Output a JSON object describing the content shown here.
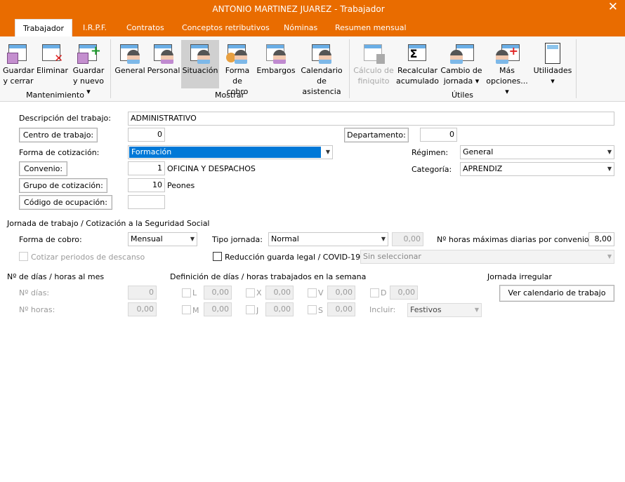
{
  "window": {
    "title": "ANTONIO MARTINEZ JUAREZ - Trabajador",
    "close_icon": "close-icon"
  },
  "tabs": [
    "Trabajador",
    "I.R.P.F.",
    "Contratos",
    "Conceptos retributivos",
    "Nóminas",
    "Resumen mensual"
  ],
  "ribbon": {
    "groups": [
      "Mantenimiento",
      "Mostrar",
      "Útiles"
    ],
    "buttons": [
      {
        "l1": "Guardar",
        "l2": "y cerrar"
      },
      {
        "l1": "Eliminar",
        "l2": ""
      },
      {
        "l1": "Guardar",
        "l2": "y nuevo ▾"
      },
      {
        "l1": "General",
        "l2": ""
      },
      {
        "l1": "Personal",
        "l2": ""
      },
      {
        "l1": "Situación",
        "l2": ""
      },
      {
        "l1": "Forma",
        "l2": "de cobro"
      },
      {
        "l1": "Embargos",
        "l2": ""
      },
      {
        "l1": "Calendario",
        "l2": "de asistencia"
      },
      {
        "l1": "Cálculo de",
        "l2": "finiquito"
      },
      {
        "l1": "Recalcular",
        "l2": "acumulado"
      },
      {
        "l1": "Cambio de",
        "l2": "jornada ▾"
      },
      {
        "l1": "Más",
        "l2": "opciones... ▾"
      },
      {
        "l1": "Utilidades",
        "l2": "▾"
      }
    ]
  },
  "form": {
    "descripcion_label": "Descripción del trabajo:",
    "descripcion": "ADMINISTRATIVO",
    "centro_btn": "Centro de trabajo:",
    "centro": "0",
    "departamento_btn": "Departamento:",
    "departamento": "0",
    "forma_cot_label": "Forma de cotización:",
    "forma_cot": "Formación",
    "regimen_label": "Régimen:",
    "regimen": "General",
    "convenio_btn": "Convenio:",
    "convenio": "1",
    "convenio_text": "OFICINA Y DESPACHOS",
    "categoria_label": "Categoría:",
    "categoria": "APRENDIZ",
    "grupo_btn": "Grupo de cotización:",
    "grupo": "10",
    "grupo_text": "Peones",
    "codigo_btn": "Código de ocupación:",
    "codigo": ""
  },
  "jornada": {
    "section": "Jornada de trabajo / Cotización a la Seguridad Social",
    "forma_cobro_label": "Forma de cobro:",
    "forma_cobro": "Mensual",
    "tipo_label": "Tipo jornada:",
    "tipo": "Normal",
    "tipo_value": "0,00",
    "horas_max_label": "Nº horas máximas diarias por convenio:",
    "horas_max": "8,00",
    "cotizar_label": "Cotizar periodos de descanso",
    "reduccion_label": "Reducción guarda legal / COVID-19",
    "reduccion_select": "Sin seleccionar"
  },
  "mes": {
    "title": "Nº de días / horas al mes",
    "dias_label": "Nº días:",
    "dias": "0",
    "horas_label": "Nº horas:",
    "horas": "0,00"
  },
  "semana": {
    "title": "Definición de días / horas trabajados en la semana",
    "days": [
      {
        "d": "L",
        "v": "0,00"
      },
      {
        "d": "X",
        "v": "0,00"
      },
      {
        "d": "V",
        "v": "0,00"
      },
      {
        "d": "D",
        "v": "0,00"
      },
      {
        "d": "M",
        "v": "0,00"
      },
      {
        "d": "J",
        "v": "0,00"
      },
      {
        "d": "S",
        "v": "0,00"
      }
    ],
    "incluir_label": "Incluir:",
    "incluir": "Festivos"
  },
  "irregular": {
    "title": "Jornada irregular",
    "button": "Ver calendario de trabajo"
  }
}
